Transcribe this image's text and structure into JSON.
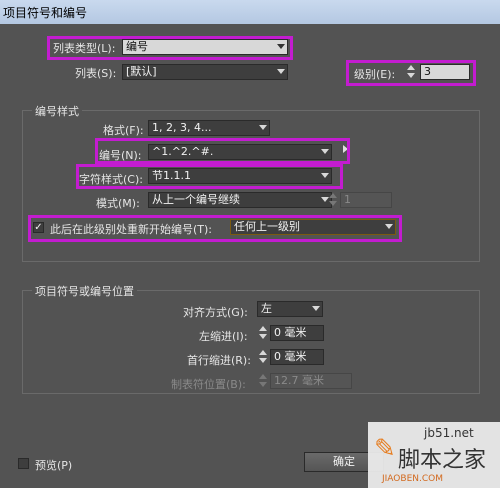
{
  "window": {
    "title": "项目符号和编号"
  },
  "list": {
    "type_label": "列表类型(L):",
    "type_value": "编号",
    "list_label": "列表(S):",
    "list_value": "[默认]",
    "level_label": "级别(E):",
    "level_value": "3"
  },
  "numbering_style": {
    "group_title": "编号样式",
    "format_label": "格式(F):",
    "format_value": "1, 2, 3, 4...",
    "number_label": "编号(N):",
    "number_value": "^1.^2.^#.",
    "char_style_label": "字符样式(C):",
    "char_style_value": "节1.1.1",
    "mode_label": "模式(M):",
    "mode_value": "从上一个编号继续",
    "mode_number": "1",
    "restart_label": "此后在此级别处重新开始编号(T):",
    "restart_checked": true,
    "restart_value": "任何上一级别"
  },
  "position": {
    "group_title": "项目符号或编号位置",
    "align_label": "对齐方式(G):",
    "align_value": "左",
    "left_indent_label": "左缩进(I):",
    "left_indent_value": "0 毫米",
    "first_indent_label": "首行缩进(R):",
    "first_indent_value": "0 毫米",
    "tab_label": "制表符位置(B):",
    "tab_value": "12.7 毫米"
  },
  "footer": {
    "preview_label": "预览(P)",
    "ok_label": "确定"
  },
  "watermark": {
    "url": "jb51.net",
    "text": "脚本之家",
    "sub": "JIAOBEN.COM"
  },
  "colors": {
    "highlight": "#c31cd0",
    "dialog_bg": "#535353"
  }
}
